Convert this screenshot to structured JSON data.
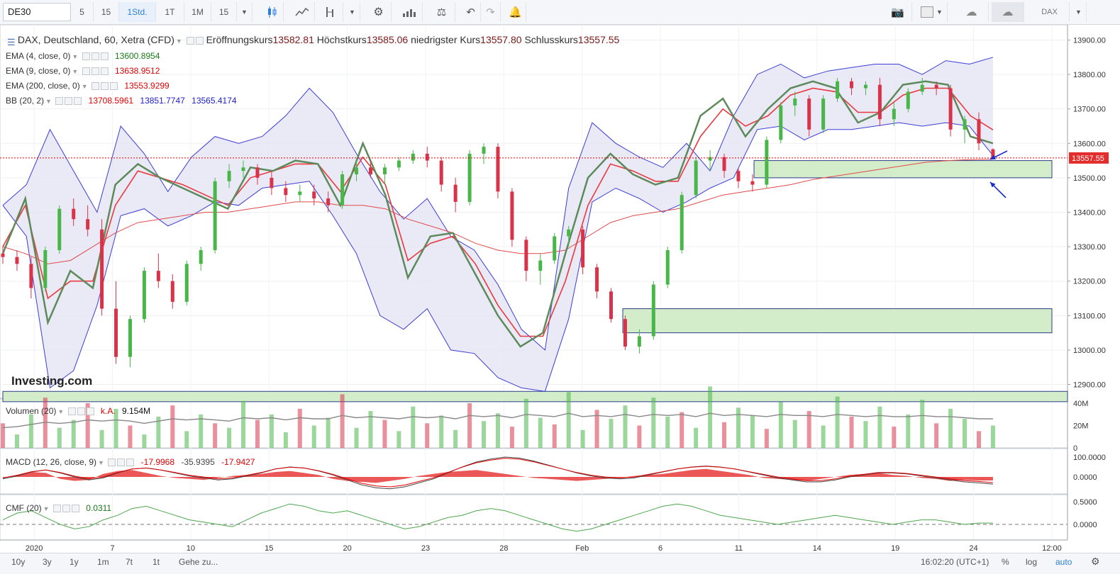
{
  "toolbar": {
    "symbol": "DE30",
    "intervals": [
      "5",
      "15",
      "1Std.",
      "1T",
      "1M",
      "15"
    ],
    "active_interval": "1Std.",
    "right_symbol": "DAX",
    "icons": [
      "candlestick-icon",
      "line-chart-icon",
      "indicator-icon",
      "settings-icon",
      "bars-icon",
      "scale-icon",
      "undo-icon",
      "redo-icon",
      "alert-icon",
      "camera-icon",
      "color-icon",
      "cloud-download-icon",
      "cloud-upload-icon"
    ]
  },
  "main": {
    "title": "DAX, Deutschland, 60, Xetra (CFD)",
    "open_label": "Eröffnungskurs",
    "open_value": "13582.81",
    "high_label": "Höchstkurs",
    "high_value": "13585.06",
    "low_label": "niedrigster Kurs",
    "low_value": "13557.80",
    "close_label": "Schlusskurs",
    "close_value": "13557.55",
    "indicators": [
      {
        "label": "EMA (4, close, 0)",
        "values": [
          "13600.8954"
        ],
        "colors": [
          "#1a7a1a"
        ]
      },
      {
        "label": "EMA (9, close, 0)",
        "values": [
          "13638.9512"
        ],
        "colors": [
          "#e00000"
        ]
      },
      {
        "label": "EMA (200, close, 0)",
        "values": [
          "13553.9299"
        ],
        "colors": [
          "#e00000"
        ]
      },
      {
        "label": "BB (20, 2)",
        "values": [
          "13708.5961",
          "13851.7747",
          "13565.4174"
        ],
        "colors": [
          "#e00000",
          "#1d1dc8",
          "#1d1dc8"
        ]
      }
    ],
    "last_price_tag": "13557.55",
    "watermark": "Investing.com"
  },
  "volume": {
    "label": "Volumen (20)",
    "na": "k.A.",
    "value": "9.154M",
    "axis_ticks": [
      "40M",
      "20M",
      "0"
    ]
  },
  "macd": {
    "label": "MACD (12, 26, close, 9)",
    "values": [
      "-17.9968",
      "-35.9395",
      "-17.9427"
    ],
    "axis_ticks": [
      "100.0000",
      "0.0000"
    ]
  },
  "cmf": {
    "label": "CMF (20)",
    "value": "0.0311",
    "axis_ticks": [
      "0.5000",
      "0.0000"
    ]
  },
  "time_axis": [
    "2020",
    "7",
    "10",
    "15",
    "20",
    "23",
    "28",
    "Feb",
    "6",
    "11",
    "14",
    "19",
    "24",
    "12:00"
  ],
  "bottombar": {
    "ranges": [
      "10y",
      "3y",
      "1y",
      "1m",
      "7t",
      "1t"
    ],
    "goto": "Gehe zu...",
    "clock": "16:02:20 (UTC+1)",
    "percent": "%",
    "log": "log",
    "auto": "auto"
  },
  "colors": {
    "up": "#48b648",
    "down": "#d9334a",
    "bb_fill": "#e3e3f4",
    "bb_line": "#3c3cd8",
    "zone_fill": "#d3ecc9",
    "zone_border": "#2c3e8c",
    "accent": "#2e7fd6"
  },
  "chart_data": {
    "type": "line",
    "title": "DAX, Deutschland, 60, Xetra (CFD)",
    "xlabel": "",
    "ylabel": "",
    "ylim": [
      12860,
      13940
    ],
    "y_ticks": [
      12900,
      13000,
      13100,
      13200,
      13300,
      13400,
      13500,
      13600,
      13700,
      13800,
      13900
    ],
    "x_ticks": [
      "2020",
      "7",
      "10",
      "15",
      "20",
      "23",
      "28",
      "Feb",
      "6",
      "11",
      "14",
      "19",
      "24",
      "12:00"
    ],
    "x": [
      0,
      0.25,
      0.5,
      0.75,
      1,
      1.25,
      1.5,
      1.75,
      2,
      2.25,
      2.5,
      2.75,
      3,
      3.25,
      3.5,
      3.75,
      4,
      4.25,
      4.5,
      4.75,
      5,
      5.25,
      5.5,
      5.75,
      6,
      6.25,
      6.5,
      6.75,
      7,
      7.25,
      7.5,
      7.75,
      8,
      8.25,
      8.5,
      8.75,
      9,
      9.25,
      9.5,
      9.75,
      10,
      10.25,
      10.5,
      10.75,
      11,
      11.25,
      11.5,
      11.75,
      12,
      12.25,
      12.5
    ],
    "series": [
      {
        "name": "EMA (4, close, 0)",
        "values": [
          13280,
          13440,
          13080,
          13230,
          13180,
          13480,
          13540,
          13500,
          13470,
          13440,
          13410,
          13530,
          13520,
          13550,
          13540,
          13420,
          13600,
          13450,
          13210,
          13330,
          13340,
          13220,
          13100,
          13010,
          13050,
          13280,
          13500,
          13570,
          13510,
          13480,
          13500,
          13680,
          13730,
          13620,
          13700,
          13760,
          13780,
          13760,
          13660,
          13690,
          13770,
          13780,
          13770,
          13620,
          13600
        ]
      },
      {
        "name": "EMA (9, close, 0)",
        "values": [
          13300,
          13420,
          13150,
          13200,
          13200,
          13420,
          13520,
          13500,
          13480,
          13450,
          13420,
          13500,
          13520,
          13540,
          13540,
          13460,
          13560,
          13480,
          13260,
          13310,
          13330,
          13250,
          13130,
          13040,
          13040,
          13200,
          13420,
          13540,
          13520,
          13490,
          13490,
          13620,
          13700,
          13650,
          13680,
          13740,
          13760,
          13750,
          13690,
          13690,
          13740,
          13760,
          13760,
          13680,
          13639
        ]
      },
      {
        "name": "EMA (200, close, 0)",
        "values": [
          13300,
          13280,
          13250,
          13260,
          13300,
          13340,
          13370,
          13380,
          13390,
          13400,
          13400,
          13410,
          13420,
          13430,
          13430,
          13420,
          13420,
          13410,
          13380,
          13360,
          13340,
          13310,
          13290,
          13280,
          13280,
          13290,
          13330,
          13370,
          13390,
          13400,
          13410,
          13430,
          13450,
          13460,
          13470,
          13480,
          13495,
          13505,
          13515,
          13525,
          13535,
          13545,
          13550,
          13553,
          13554
        ]
      },
      {
        "name": "BB (20, 2)",
        "values": [
          13420,
          13480,
          13640,
          13520,
          13400,
          13650,
          13570,
          13460,
          13560,
          13620,
          13600,
          13620,
          13680,
          13760,
          13690,
          13570,
          13460,
          13380,
          13440,
          13330,
          13290,
          13190,
          13060,
          13000,
          13470,
          13660,
          13600,
          13560,
          13530,
          13600,
          13520,
          13680,
          13800,
          13830,
          13790,
          13810,
          13820,
          13830,
          13830,
          13800,
          13840,
          13830,
          13850
        ]
      },
      {
        "name": "BB (20, 2)",
        "values": [
          13420,
          13330,
          12890,
          12940,
          13130,
          13390,
          13410,
          13360,
          13390,
          13430,
          13420,
          13470,
          13480,
          13490,
          13390,
          13280,
          13100,
          13060,
          13120,
          13000,
          12990,
          12920,
          12890,
          12880,
          13090,
          13430,
          13470,
          13440,
          13400,
          13430,
          13470,
          13500,
          13640,
          13650,
          13610,
          13640,
          13640,
          13650,
          13660,
          13650,
          13660,
          13650,
          13565
        ]
      }
    ],
    "candles": [
      [
        13280,
        13300,
        13250,
        13270
      ],
      [
        13270,
        13290,
        13230,
        13250
      ],
      [
        13250,
        13270,
        13150,
        13180
      ],
      [
        13180,
        13300,
        13170,
        13290
      ],
      [
        13290,
        13420,
        13280,
        13410
      ],
      [
        13410,
        13440,
        13360,
        13380
      ],
      [
        13380,
        13420,
        13330,
        13350
      ],
      [
        13350,
        13380,
        13100,
        13120
      ],
      [
        13120,
        13200,
        12960,
        12980
      ],
      [
        12980,
        13100,
        12950,
        13090
      ],
      [
        13090,
        13240,
        13080,
        13230
      ],
      [
        13230,
        13280,
        13180,
        13200
      ],
      [
        13200,
        13220,
        13120,
        13140
      ],
      [
        13140,
        13260,
        13130,
        13250
      ],
      [
        13250,
        13300,
        13230,
        13290
      ],
      [
        13290,
        13500,
        13280,
        13490
      ],
      [
        13490,
        13540,
        13470,
        13520
      ],
      [
        13520,
        13550,
        13500,
        13530
      ],
      [
        13530,
        13540,
        13480,
        13500
      ],
      [
        13500,
        13520,
        13450,
        13470
      ],
      [
        13470,
        13490,
        13430,
        13450
      ],
      [
        13450,
        13480,
        13430,
        13460
      ],
      [
        13460,
        13480,
        13420,
        13440
      ],
      [
        13440,
        13460,
        13400,
        13420
      ],
      [
        13420,
        13520,
        13410,
        13510
      ],
      [
        13510,
        13550,
        13490,
        13530
      ],
      [
        13530,
        13550,
        13500,
        13510
      ],
      [
        13510,
        13540,
        13480,
        13530
      ],
      [
        13530,
        13560,
        13520,
        13550
      ],
      [
        13550,
        13580,
        13540,
        13570
      ],
      [
        13570,
        13590,
        13530,
        13550
      ],
      [
        13550,
        13560,
        13460,
        13480
      ],
      [
        13480,
        13500,
        13400,
        13430
      ],
      [
        13430,
        13580,
        13420,
        13570
      ],
      [
        13570,
        13600,
        13540,
        13590
      ],
      [
        13590,
        13600,
        13440,
        13460
      ],
      [
        13460,
        13470,
        13300,
        13320
      ],
      [
        13320,
        13330,
        13200,
        13230
      ],
      [
        13230,
        13280,
        13190,
        13260
      ],
      [
        13260,
        13340,
        13250,
        13330
      ],
      [
        13330,
        13360,
        13300,
        13350
      ],
      [
        13350,
        13360,
        13220,
        13240
      ],
      [
        13240,
        13250,
        13150,
        13170
      ],
      [
        13170,
        13180,
        13080,
        13090
      ],
      [
        13090,
        13100,
        13000,
        13010
      ],
      [
        13010,
        13060,
        12990,
        13040
      ],
      [
        13040,
        13200,
        13030,
        13190
      ],
      [
        13190,
        13300,
        13180,
        13290
      ],
      [
        13290,
        13460,
        13280,
        13450
      ],
      [
        13450,
        13560,
        13440,
        13550
      ],
      [
        13550,
        13580,
        13520,
        13560
      ],
      [
        13560,
        13570,
        13500,
        13520
      ],
      [
        13520,
        13530,
        13470,
        13490
      ],
      [
        13490,
        13510,
        13460,
        13480
      ],
      [
        13480,
        13620,
        13470,
        13610
      ],
      [
        13610,
        13720,
        13600,
        13710
      ],
      [
        13710,
        13750,
        13680,
        13730
      ],
      [
        13730,
        13740,
        13620,
        13640
      ],
      [
        13640,
        13740,
        13630,
        13730
      ],
      [
        13730,
        13790,
        13720,
        13780
      ],
      [
        13780,
        13790,
        13740,
        13760
      ],
      [
        13760,
        13780,
        13740,
        13770
      ],
      [
        13770,
        13790,
        13650,
        13670
      ],
      [
        13670,
        13720,
        13650,
        13700
      ],
      [
        13700,
        13760,
        13690,
        13750
      ],
      [
        13750,
        13790,
        13740,
        13770
      ],
      [
        13770,
        13780,
        13740,
        13760
      ],
      [
        13760,
        13770,
        13620,
        13640
      ],
      [
        13640,
        13680,
        13600,
        13670
      ],
      [
        13670,
        13690,
        13580,
        13600
      ],
      [
        13582.81,
        13585.06,
        13557.8,
        13557.55
      ]
    ],
    "zones": [
      [
        13500,
        13550
      ],
      [
        13050,
        13120
      ],
      [
        12850,
        12880
      ]
    ],
    "volume": [
      22,
      12,
      30,
      45,
      18,
      25,
      40,
      16,
      35,
      20,
      12,
      28,
      38,
      15,
      30,
      22,
      18,
      42,
      25,
      30,
      14,
      35,
      20,
      27,
      48,
      18,
      33,
      25,
      15,
      37,
      22,
      29,
      16,
      40,
      24,
      31,
      19,
      44,
      27,
      21,
      50,
      16,
      34,
      26,
      38,
      20,
      45,
      28,
      32,
      18,
      55,
      23,
      36,
      29,
      17,
      41,
      25,
      33,
      20,
      46,
      28,
      24,
      37,
      19,
      30,
      43,
      22,
      35,
      26,
      15,
      20
    ],
    "volume_avg": [
      18,
      19,
      21,
      23,
      22,
      23,
      25,
      24,
      25,
      24,
      22,
      24,
      26,
      25,
      26,
      25,
      24,
      27,
      26,
      27,
      25,
      27,
      26,
      26,
      29,
      27,
      28,
      27,
      26,
      28,
      27,
      28,
      26,
      29,
      28,
      29,
      27,
      30,
      29,
      28,
      31,
      28,
      29,
      28,
      30,
      28,
      30,
      29,
      30,
      28,
      31,
      29,
      30,
      29,
      28,
      30,
      29,
      29,
      28,
      30,
      29,
      28,
      29,
      28,
      28,
      29,
      28,
      28,
      27,
      26,
      26
    ],
    "macd_hist": [
      -5,
      10,
      25,
      20,
      -10,
      -20,
      -15,
      15,
      30,
      35,
      20,
      5,
      -5,
      -10,
      -15,
      -5,
      5,
      10,
      15,
      25,
      30,
      20,
      10,
      -10,
      -20,
      -25,
      -30,
      -20,
      -10,
      5,
      15,
      25,
      30,
      35,
      25,
      15,
      5,
      -5,
      -10,
      -15,
      -20,
      -15,
      -10,
      -5,
      5,
      10,
      15,
      25,
      35,
      40,
      30,
      20,
      10,
      -5,
      -10,
      -15,
      -20,
      -10,
      0,
      10,
      15,
      20,
      10,
      5,
      -5,
      -10,
      -20,
      -15,
      -18,
      -18
    ],
    "macd_line": [
      -10,
      5,
      25,
      35,
      20,
      0,
      -15,
      -5,
      20,
      40,
      45,
      35,
      20,
      5,
      -5,
      -15,
      -10,
      5,
      20,
      40,
      50,
      45,
      30,
      10,
      -15,
      -40,
      -55,
      -60,
      -50,
      -30,
      -10,
      20,
      50,
      75,
      90,
      100,
      95,
      80,
      60,
      40,
      20,
      5,
      -5,
      -10,
      -5,
      10,
      25,
      40,
      50,
      55,
      50,
      40,
      25,
      10,
      -5,
      -15,
      -25,
      -25,
      -15,
      0,
      10,
      20,
      20,
      15,
      5,
      -5,
      -15,
      -25,
      -30,
      -36
    ],
    "cmf": [
      0.1,
      0.25,
      0.3,
      0.15,
      0.0,
      -0.1,
      -0.05,
      0.1,
      0.2,
      0.35,
      0.4,
      0.3,
      0.2,
      0.1,
      0.05,
      0.0,
      -0.05,
      0.1,
      0.25,
      0.35,
      0.45,
      0.4,
      0.3,
      0.25,
      0.3,
      0.2,
      0.1,
      0.0,
      -0.1,
      -0.05,
      0.05,
      0.15,
      0.2,
      0.3,
      0.35,
      0.3,
      0.2,
      0.1,
      0.0,
      -0.1,
      -0.15,
      -0.1,
      0.0,
      0.1,
      0.2,
      0.3,
      0.4,
      0.45,
      0.4,
      0.3,
      0.2,
      0.15,
      0.1,
      0.05,
      0.0,
      0.05,
      0.1,
      0.15,
      0.2,
      0.15,
      0.1,
      0.05,
      0.0,
      0.05,
      0.1,
      0.1,
      0.05,
      0.0,
      0.03,
      0.03
    ]
  }
}
